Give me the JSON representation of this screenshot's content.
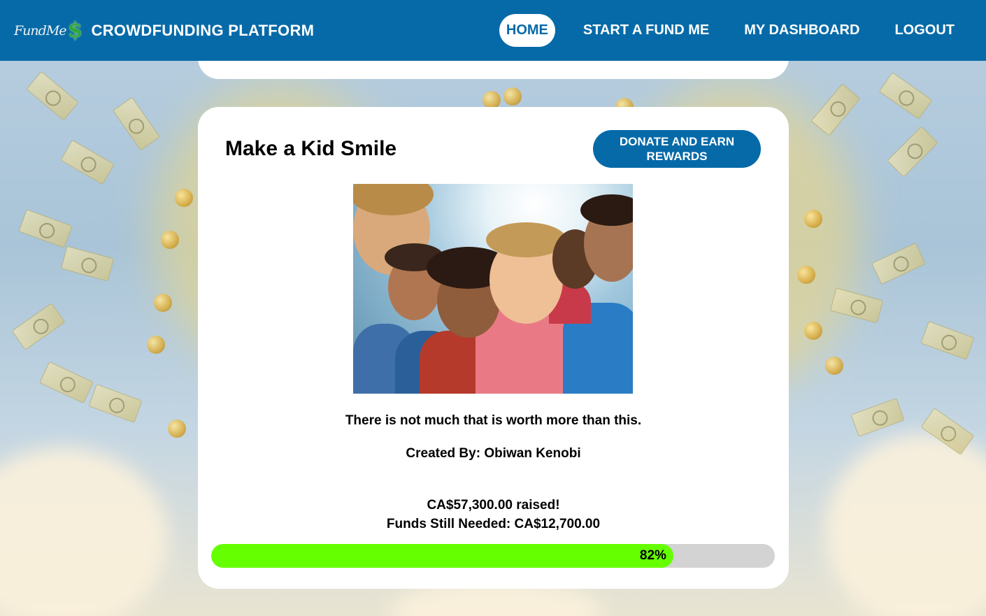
{
  "header": {
    "logo_script": "FundMe",
    "logo_symbol": "$",
    "app_title": "CROWDFUNDING PLATFORM",
    "nav": [
      {
        "label": "HOME",
        "active": true
      },
      {
        "label": "START A FUND ME",
        "active": false
      },
      {
        "label": "MY DASHBOARD",
        "active": false
      },
      {
        "label": "LOGOUT",
        "active": false
      }
    ]
  },
  "campaign": {
    "title": "Make a Kid Smile",
    "donate_label": "DONATE AND EARN REWARDS",
    "description": "There is not much that is worth more than this.",
    "created_by": "Created By: Obiwan Kenobi",
    "raised": "CA$57,300.00 raised!",
    "funds_needed": "Funds Still Needed: CA$12,700.00",
    "progress_percent": 82,
    "progress_label": "82%"
  },
  "colors": {
    "brand": "#066aa8",
    "progress": "#66ff00",
    "track": "#d3d3d3"
  }
}
